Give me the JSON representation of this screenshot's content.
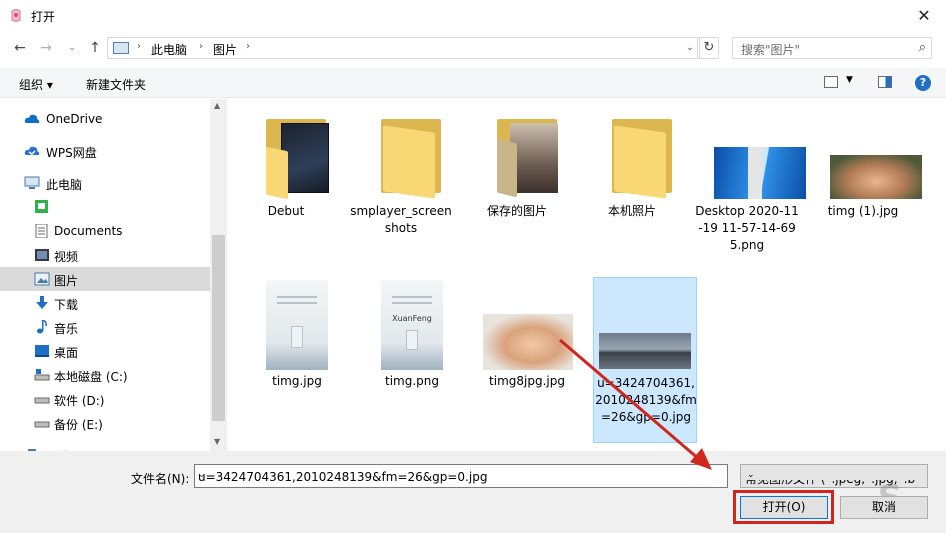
{
  "window": {
    "title": "打开"
  },
  "address": {
    "breadcrumbs": [
      "此电脑",
      "图片"
    ]
  },
  "search": {
    "placeholder": "搜索\"图片\""
  },
  "toolbar": {
    "organize": "组织 ▾",
    "new_folder": "新建文件夹"
  },
  "nav": {
    "items": [
      {
        "label": "OneDrive",
        "icon": "cloud-icon"
      },
      {
        "label": "WPS网盘",
        "icon": "wps-cloud-icon"
      },
      {
        "label": "此电脑",
        "icon": "computer-icon"
      },
      {
        "label": "",
        "icon": "green-app-icon"
      },
      {
        "label": "Documents",
        "icon": "documents-icon"
      },
      {
        "label": "视频",
        "icon": "video-icon"
      },
      {
        "label": "图片",
        "icon": "pictures-icon",
        "selected": true
      },
      {
        "label": "下载",
        "icon": "download-icon"
      },
      {
        "label": "音乐",
        "icon": "music-icon"
      },
      {
        "label": "桌面",
        "icon": "desktop-icon"
      },
      {
        "label": "本地磁盘 (C:)",
        "icon": "drive-icon"
      },
      {
        "label": "软件 (D:)",
        "icon": "drive-icon"
      },
      {
        "label": "备份 (E:)",
        "icon": "drive-icon"
      },
      {
        "label": "网络",
        "icon": "network-icon"
      }
    ]
  },
  "files": [
    {
      "name": "Debut",
      "kind": "folder"
    },
    {
      "name": "smplayer_screenshots",
      "kind": "folder"
    },
    {
      "name": "保存的图片",
      "kind": "folder"
    },
    {
      "name": "本机照片",
      "kind": "folder"
    },
    {
      "name": "Desktop 2020-11-19 11-57-14-695.png",
      "kind": "image"
    },
    {
      "name": "timg (1).jpg",
      "kind": "image"
    },
    {
      "name": "timg.jpg",
      "kind": "image"
    },
    {
      "name": "timg.png",
      "kind": "image",
      "thumb_text": "XuanFeng"
    },
    {
      "name": "timg8jpg.jpg",
      "kind": "image"
    },
    {
      "name": "u=3424704361,2010248139&fm=26&gp=0.jpg",
      "kind": "image",
      "selected": true
    }
  ],
  "footer": {
    "filename_label": "文件名(N):",
    "filename_value": "u=3424704361,2010248139&fm=26&gp=0.jpg",
    "filetype_value": "常见图形文件 (*.jpeg;*.jpg;*.b",
    "open_label": "打开(O)",
    "cancel_label": "取消"
  },
  "colors": {
    "accent": "#0078d7",
    "highlight": "#d2251d",
    "selection": "#cce8ff"
  }
}
